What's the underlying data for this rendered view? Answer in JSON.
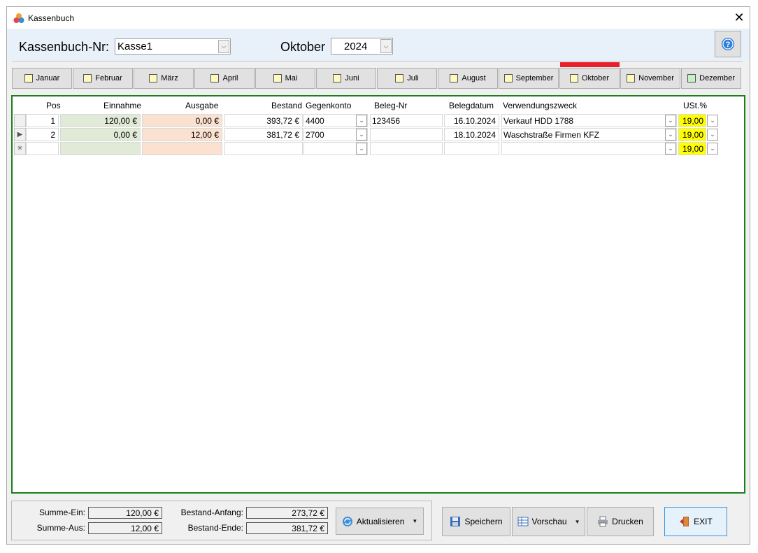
{
  "window": {
    "title": "Kassenbuch",
    "close_glyph": "✕"
  },
  "header": {
    "kassenbuch_label": "Kassenbuch-Nr:",
    "kassenbuch_value": "Kasse1",
    "month_label": "Oktober",
    "year_value": "2024"
  },
  "months": [
    {
      "label": "Januar"
    },
    {
      "label": "Februar"
    },
    {
      "label": "März"
    },
    {
      "label": "April"
    },
    {
      "label": "Mai"
    },
    {
      "label": "Juni"
    },
    {
      "label": "Juli"
    },
    {
      "label": "August"
    },
    {
      "label": "September"
    },
    {
      "label": "Oktober"
    },
    {
      "label": "November"
    },
    {
      "label": "Dezember"
    }
  ],
  "active_month": "Oktober",
  "grid": {
    "columns": {
      "pos": "Pos",
      "einnahme": "Einnahme",
      "ausgabe": "Ausgabe",
      "bestand": "Bestand",
      "gegenkonto": "Gegenkonto",
      "beleg_nr": "Beleg-Nr",
      "belegdatum": "Belegdatum",
      "verwendungszweck": "Verwendungszweck",
      "ust": "USt.%"
    },
    "rows": [
      {
        "pos": "1",
        "einnahme": "120,00 €",
        "ausgabe": "0,00 €",
        "bestand": "393,72 €",
        "gegenkonto": "4400",
        "beleg_nr": "123456",
        "belegdatum": "16.10.2024",
        "verwendungszweck": "Verkauf HDD 1788",
        "ust": "19,00"
      },
      {
        "pos": "2",
        "einnahme": "0,00 €",
        "ausgabe": "12,00 €",
        "bestand": "381,72 €",
        "gegenkonto": "2700",
        "beleg_nr": "",
        "belegdatum": "18.10.2024",
        "verwendungszweck": "Waschstraße Firmen KFZ",
        "ust": "19,00"
      },
      {
        "pos": "",
        "einnahme": "",
        "ausgabe": "",
        "bestand": "",
        "gegenkonto": "",
        "beleg_nr": "",
        "belegdatum": "",
        "verwendungszweck": "",
        "ust": "19,00"
      }
    ],
    "row_indicators": [
      "",
      "▶",
      "✳"
    ]
  },
  "summary": {
    "summe_ein_label": "Summe-Ein:",
    "summe_ein_value": "120,00 €",
    "summe_aus_label": "Summe-Aus:",
    "summe_aus_value": "12,00 €",
    "bestand_anfang_label": "Bestand-Anfang:",
    "bestand_anfang_value": "273,72 €",
    "bestand_ende_label": "Bestand-Ende:",
    "bestand_ende_value": "381,72 €"
  },
  "buttons": {
    "aktualisieren": "Aktualisieren",
    "speichern": "Speichern",
    "vorschau": "Vorschau",
    "drucken": "Drucken",
    "exit": "EXIT"
  },
  "colors": {
    "active_month_bar": "#e8202a",
    "grid_border": "#1b7d1b",
    "einnahme_bg": "#e1ead6",
    "ausgabe_bg": "#fbe1d0",
    "ust_bg": "#ffff00"
  }
}
